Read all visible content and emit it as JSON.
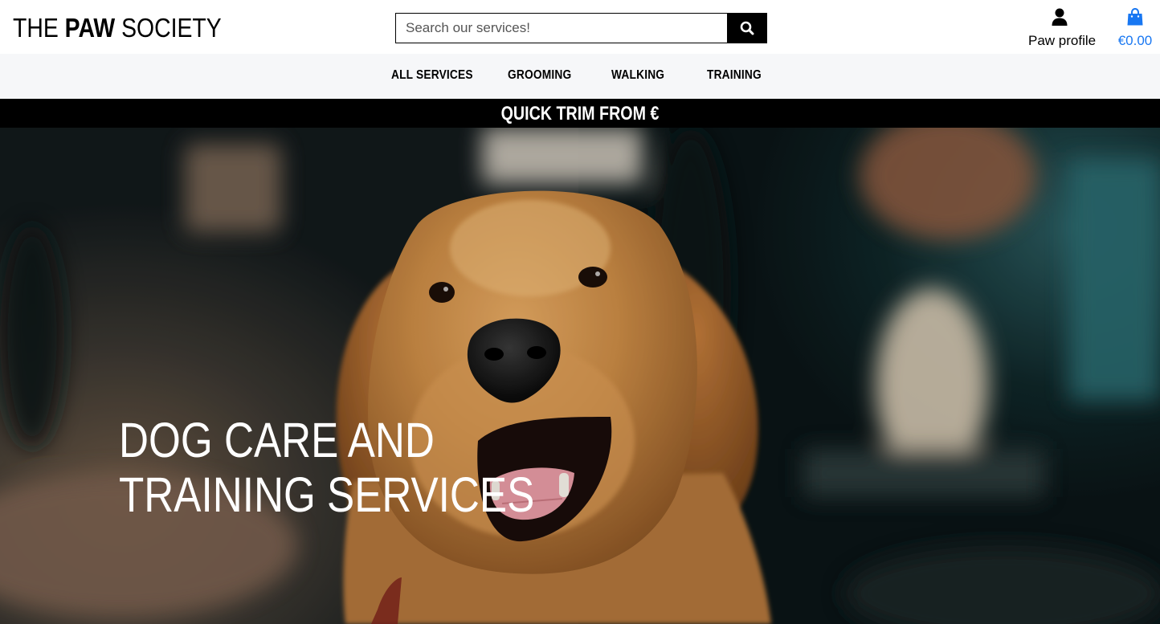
{
  "brand": {
    "part1": "THE ",
    "part2": "PAW",
    "part3": " SOCIETY"
  },
  "search": {
    "placeholder": "Search our services!",
    "value": "",
    "button_icon": "search-icon"
  },
  "account": {
    "label": "Paw profile",
    "icon": "user-icon"
  },
  "cart": {
    "amount": "€0.00",
    "icon": "shopping-bag-icon",
    "color": "#1877f2"
  },
  "nav": {
    "items": [
      {
        "label": "ALL SERVICES"
      },
      {
        "label": "GROOMING"
      },
      {
        "label": "WALKING"
      },
      {
        "label": "TRAINING"
      }
    ]
  },
  "promo": {
    "text": "QUICK TRIM FROM €"
  },
  "hero": {
    "title": "DOG CARE AND TRAINING SERVICES"
  }
}
